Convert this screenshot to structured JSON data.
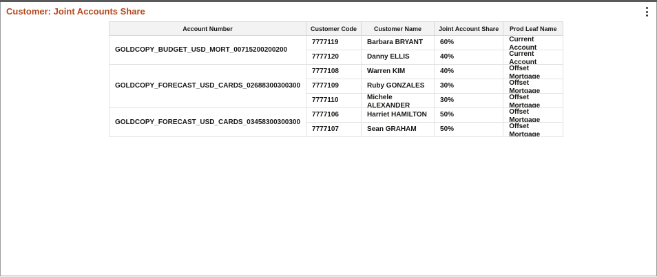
{
  "panel": {
    "title": "Customer: Joint Accounts Share"
  },
  "table": {
    "headers": [
      "Account Number",
      "Customer Code",
      "Customer Name",
      "Joint Account Share",
      "Prod Leaf Name"
    ],
    "groups": [
      {
        "account": "GOLDCOPY_BUDGET_USD_MORT_00715200200200",
        "rows": [
          {
            "code": "7777119",
            "name": "Barbara BRYANT",
            "share": "60%",
            "leaf": "Current Account"
          },
          {
            "code": "7777120",
            "name": "Danny ELLIS",
            "share": "40%",
            "leaf": "Current Account"
          }
        ]
      },
      {
        "account": "GOLDCOPY_FORECAST_USD_CARDS_02688300300300",
        "rows": [
          {
            "code": "7777108",
            "name": "Warren KIM",
            "share": "40%",
            "leaf": "Offset Mortgage"
          },
          {
            "code": "7777109",
            "name": "Ruby GONZALES",
            "share": "30%",
            "leaf": "Offset Mortgage"
          },
          {
            "code": "7777110",
            "name": "Michele ALEXANDER",
            "share": "30%",
            "leaf": "Offset Mortgage"
          }
        ]
      },
      {
        "account": "GOLDCOPY_FORECAST_USD_CARDS_03458300300300",
        "rows": [
          {
            "code": "7777106",
            "name": "Harriet HAMILTON",
            "share": "50%",
            "leaf": "Offset Mortgage"
          },
          {
            "code": "7777107",
            "name": "Sean GRAHAM",
            "share": "50%",
            "leaf": "Offset Mortgage"
          }
        ]
      }
    ]
  }
}
